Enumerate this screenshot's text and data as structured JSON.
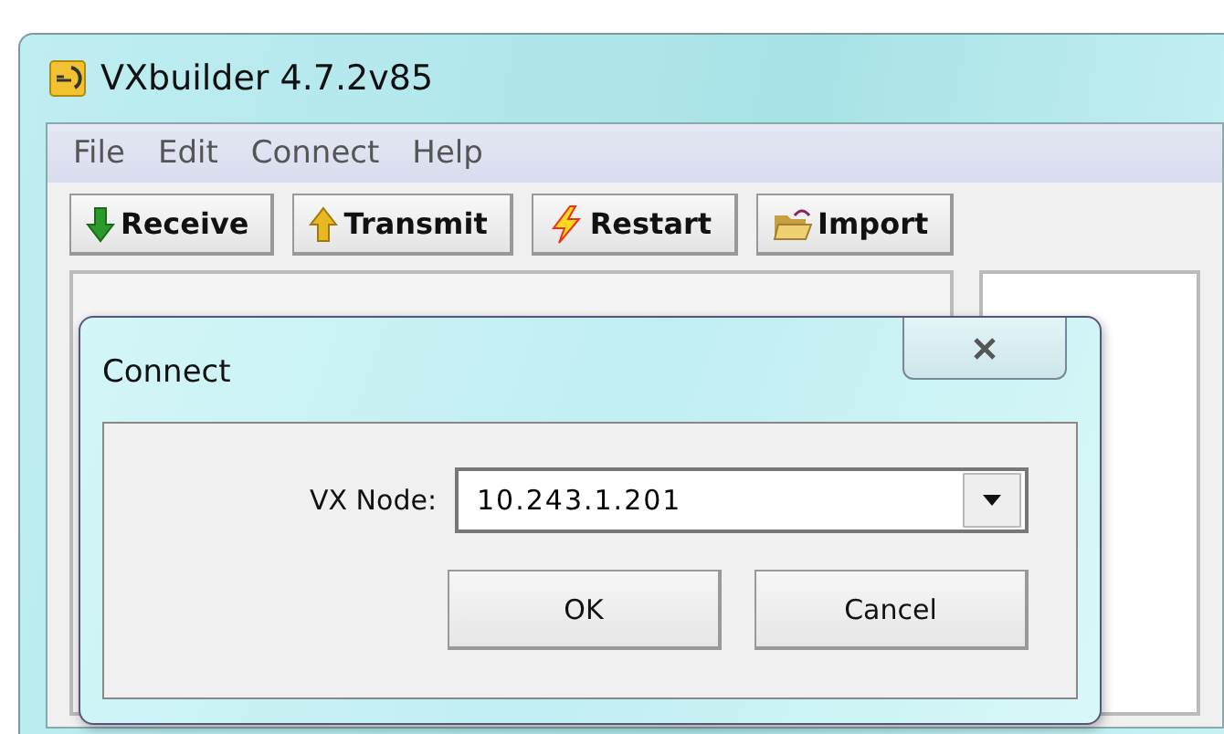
{
  "window": {
    "title": "VXbuilder 4.7.2v85"
  },
  "menu": [
    "File",
    "Edit",
    "Connect",
    "Help"
  ],
  "toolbar": [
    {
      "label": "Receive",
      "kind": "receive"
    },
    {
      "label": "Transmit",
      "kind": "transmit"
    },
    {
      "label": "Restart",
      "kind": "restart"
    },
    {
      "label": "Import",
      "kind": "import"
    }
  ],
  "dialog": {
    "title": "Connect",
    "field_label": "VX Node:",
    "value": "10.243.1.201",
    "buttons": [
      "OK",
      "Cancel"
    ]
  }
}
